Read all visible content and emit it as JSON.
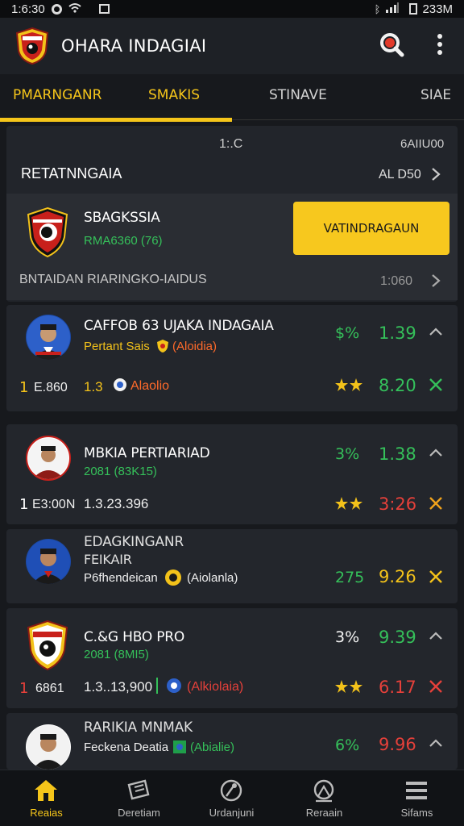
{
  "status_bar": {
    "time": "1:6:30",
    "right_text": "233M"
  },
  "header": {
    "title": "OHARA INDAGIAI"
  },
  "tabs": [
    {
      "label": "PMARNGANR",
      "active": true
    },
    {
      "label": "SMAKIS",
      "active": true
    },
    {
      "label": "STINAVE",
      "active": false
    },
    {
      "label": "SIAE",
      "active": false
    }
  ],
  "section": {
    "col_mid": "1:.C",
    "col_right": "6AIIU00",
    "title": "RETATNNGAIA",
    "title_link": "AL D50"
  },
  "featured": {
    "name": "SBAGKSSIA",
    "sub": "RMA6360 (76)",
    "button": "VATINDRAGAUN",
    "footer_label": "BNTAIDAN RIARINGKO-IAIDUS",
    "footer_value": "1:060"
  },
  "rows": [
    {
      "name": "CAFFOB 63 UJAKA INDAGAIA",
      "sub_label": "Pertant Sais",
      "sub_tag": "(Aloidia)",
      "left_num": "1",
      "left_code": "E.860",
      "mid_a": "1.3",
      "mid_b": "Alaolio",
      "pct": "$%",
      "val1": "1.39",
      "val2": "8.20",
      "val2_color": "#34c15c"
    },
    {
      "name": "MBKIA PERTIARIAD",
      "sub_label": "2081 (83K15)",
      "sub_tag": "",
      "left_num": "1",
      "left_code": "E3:00N",
      "mid_a": "1.3.23.396",
      "mid_b": "",
      "pct": "3%",
      "val1": "1.38",
      "val2": "3:26",
      "val2_color": "#e5403a"
    },
    {
      "name1": "EDAGKINGANR",
      "name2": "FEIKAIR",
      "sub_label": "P6fhendeican",
      "sub_tag": "(Aiolanla)",
      "pct": "275",
      "val1": "9.26"
    },
    {
      "name": "C.&G HBO PRO",
      "sub_label": "2081 (8MI5)",
      "sub_tag": "",
      "left_num": "1",
      "left_code": "6861",
      "mid_a": "1.3..13,900",
      "mid_b": "(Alkiolaia)",
      "pct": "3%",
      "val1": "9.39",
      "val2": "6.17",
      "val2_color": "#e5403a"
    },
    {
      "name": "RARIKIA MNMAK",
      "sub_label": "Feckena Deatia",
      "sub_tag": "(Abialie)",
      "pct": "6%",
      "val1": "9.96"
    }
  ],
  "bottom_nav": [
    {
      "label": "Reaias",
      "active": true
    },
    {
      "label": "Deretiam",
      "active": false
    },
    {
      "label": "Urdanjuni",
      "active": false
    },
    {
      "label": "Reraain",
      "active": false
    },
    {
      "label": "Sifams",
      "active": false
    }
  ]
}
